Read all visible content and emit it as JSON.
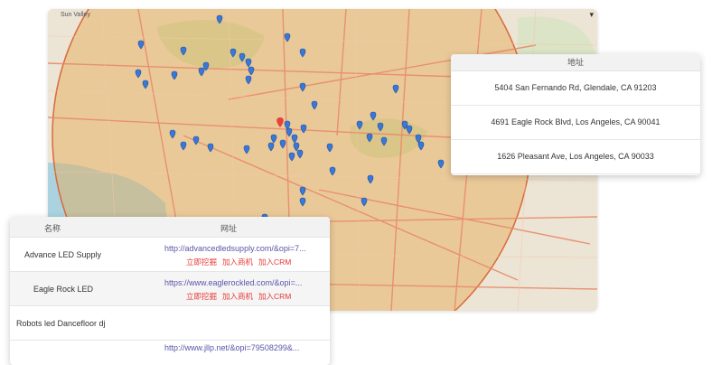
{
  "map": {
    "labels": {
      "sun_valley": "Sun Valley"
    },
    "zoom_control": "▾"
  },
  "address_panel": {
    "header": "地址",
    "rows": [
      "5404 San Fernando Rd, Glendale, CA 91203",
      "4691 Eagle Rock Blvd, Los Angeles, CA 90041",
      "1626 Pleasant Ave, Los Angeles, CA 90033"
    ]
  },
  "business_panel": {
    "headers": {
      "name": "名称",
      "website": "网址"
    },
    "rows": [
      {
        "name": "Advance LED Supply",
        "url": "http://advancedledsupply.com/&opi=7...",
        "actions": [
          "立即挖掘",
          "加入商机",
          "加入CRM"
        ]
      },
      {
        "name": "Eagle Rock LED",
        "url": "https://www.eaglerockled.com/&opi=...",
        "actions": [
          "立即挖掘",
          "加入商机",
          "加入CRM"
        ]
      },
      {
        "name": "Robots led Dancefloor dj",
        "url": "",
        "actions": []
      },
      {
        "name": "",
        "url": "http://www.jllp.net/&opi=79508299&...",
        "actions": []
      }
    ]
  },
  "colors": {
    "pin": "#3a78d8",
    "pin_selected": "#e8403a",
    "radius_fill": "#e9a84f",
    "radius_stroke": "#d86a3a",
    "action_text": "#e53935",
    "link_text": "#5b55a8"
  }
}
